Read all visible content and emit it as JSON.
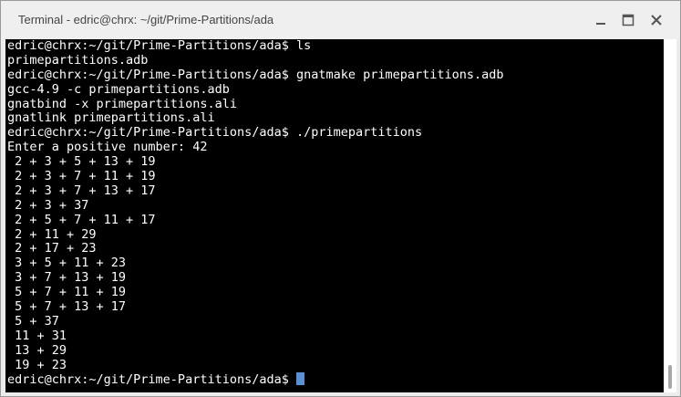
{
  "window": {
    "title": "Terminal - edric@chrx: ~/git/Prime-Partitions/ada",
    "buttons": {
      "minimize": "minimize-icon",
      "maximize": "maximize-icon",
      "close": "close-icon"
    }
  },
  "terminal": {
    "colors": {
      "background": "#000000",
      "foreground": "#ffffff",
      "cursor": "#5b8fd6"
    },
    "lines": [
      "edric@chrx:~/git/Prime-Partitions/ada$ ls",
      "primepartitions.adb",
      "edric@chrx:~/git/Prime-Partitions/ada$ gnatmake primepartitions.adb",
      "gcc-4.9 -c primepartitions.adb",
      "gnatbind -x primepartitions.ali",
      "gnatlink primepartitions.ali",
      "edric@chrx:~/git/Prime-Partitions/ada$ ./primepartitions",
      "Enter a positive number: 42",
      " 2 + 3 + 5 + 13 + 19",
      " 2 + 3 + 7 + 11 + 19",
      " 2 + 3 + 7 + 13 + 17",
      " 2 + 3 + 37",
      " 2 + 5 + 7 + 11 + 17",
      " 2 + 11 + 29",
      " 2 + 17 + 23",
      " 3 + 5 + 11 + 23",
      " 3 + 7 + 13 + 19",
      " 5 + 7 + 11 + 19",
      " 5 + 7 + 13 + 17",
      " 5 + 37",
      " 11 + 31",
      " 13 + 29",
      " 19 + 23"
    ],
    "prompt": "edric@chrx:~/git/Prime-Partitions/ada$ "
  }
}
